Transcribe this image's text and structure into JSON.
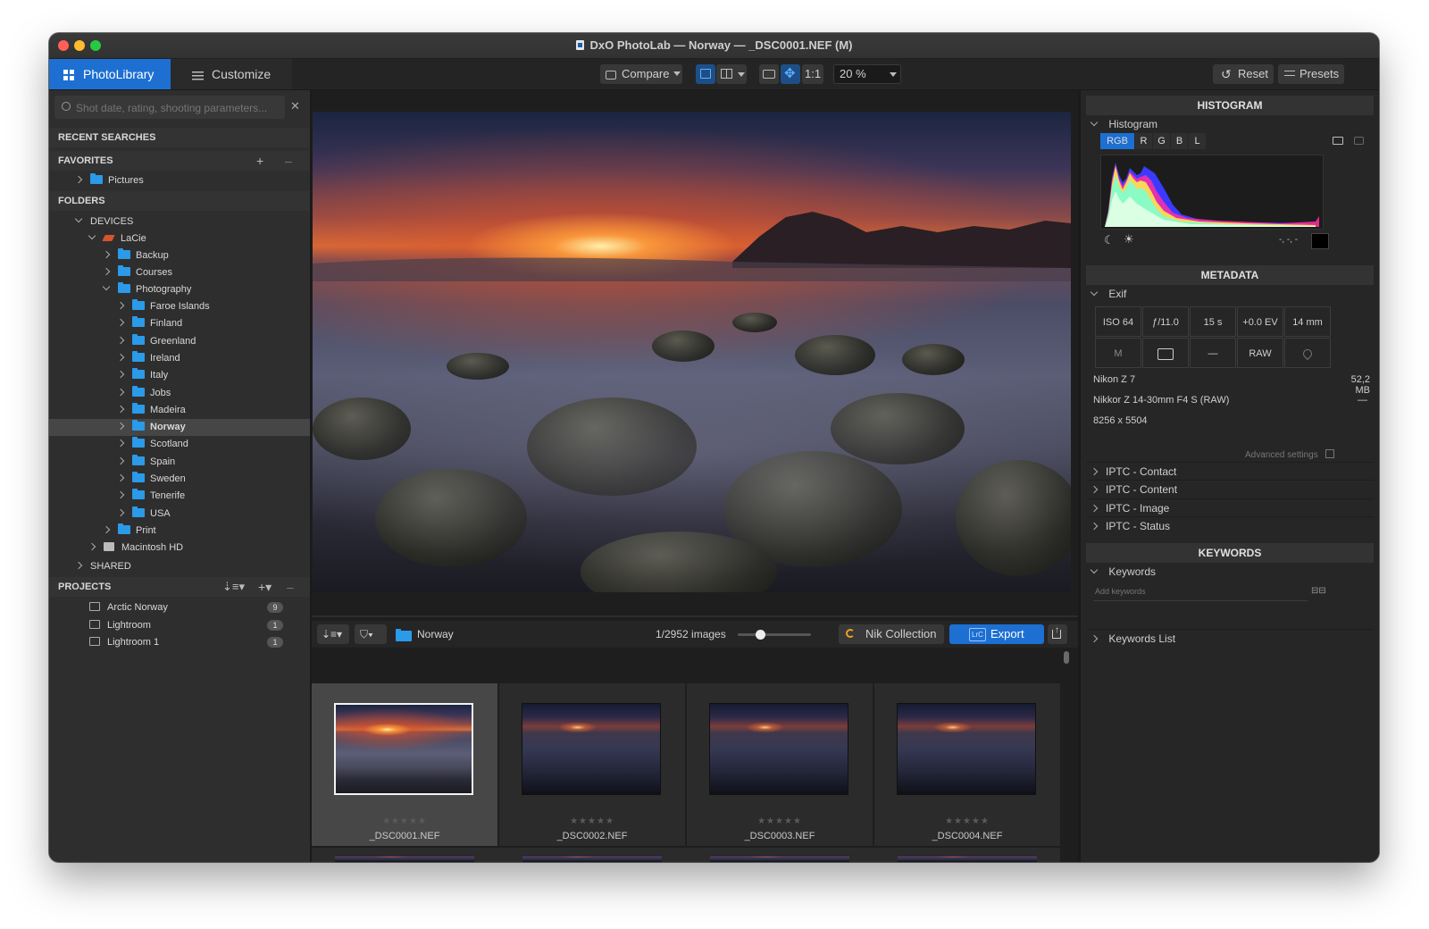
{
  "window": {
    "title": "DxO PhotoLab — Norway — _DSC0001.NEF (M)"
  },
  "toolbar": {
    "tab_library": "PhotoLibrary",
    "tab_customize": "Customize",
    "compare_label": "Compare",
    "one_to_one": "1:1",
    "zoom": "20 %",
    "reset_label": "Reset",
    "presets_label": "Presets"
  },
  "sidebar": {
    "search_placeholder": "Shot date, rating, shooting parameters...",
    "recent_searches": "RECENT SEARCHES",
    "favorites": "FAVORITES",
    "fav_items": [
      "Pictures"
    ],
    "folders": "FOLDERS",
    "devices": "DEVICES",
    "drive": "LaCie",
    "drive_children": [
      "Backup",
      "Courses",
      "Photography"
    ],
    "photography_children": [
      "Faroe Islands",
      "Finland",
      "Greenland",
      "Ireland",
      "Italy",
      "Jobs",
      "Madeira",
      "Norway",
      "Scotland",
      "Spain",
      "Sweden",
      "Tenerife",
      "USA"
    ],
    "print_folder": "Print",
    "macintosh": "Macintosh HD",
    "shared": "SHARED",
    "projects": "PROJECTS",
    "project_items": [
      {
        "name": "Arctic Norway",
        "count": "9"
      },
      {
        "name": "Lightroom",
        "count": "1"
      },
      {
        "name": "Lightroom 1",
        "count": "1"
      }
    ],
    "selected_folder": "Norway"
  },
  "filmstrip": {
    "folder": "Norway",
    "count": "1/2952 images",
    "slider_value": 0.3,
    "nik_label": "Nik Collection",
    "export_label": "Export",
    "lrc_badge": "LrC",
    "thumbs": [
      {
        "name": "_DSC0001.NEF",
        "stars": "★★★★★"
      },
      {
        "name": "_DSC0002.NEF",
        "stars": "★★★★★"
      },
      {
        "name": "_DSC0003.NEF",
        "stars": "★★★★★"
      },
      {
        "name": "_DSC0004.NEF",
        "stars": "★★★★★"
      }
    ]
  },
  "histogram": {
    "header": "HISTOGRAM",
    "label": "Histogram",
    "channels": [
      "RGB",
      "R",
      "G",
      "B",
      "L"
    ],
    "readout": "-, -, -"
  },
  "metadata": {
    "header": "METADATA",
    "exif_label": "Exif",
    "row1": [
      "ISO 64",
      "ƒ/11.0",
      "15 s",
      "+0.0 EV",
      "14 mm"
    ],
    "row2": [
      "M",
      "",
      "—",
      "RAW",
      ""
    ],
    "camera": "Nikon Z 7",
    "size": "52,2 MB",
    "lens": "Nikkor Z 14-30mm F4 S (RAW)",
    "lens_dash": "—",
    "dimensions": "8256 x 5504",
    "advanced": "Advanced settings",
    "iptc": [
      "IPTC - Contact",
      "IPTC - Content",
      "IPTC - Image",
      "IPTC - Status"
    ]
  },
  "keywords": {
    "header": "KEYWORDS",
    "label": "Keywords",
    "placeholder": "Add keywords",
    "list_label": "Keywords List"
  },
  "colors": {
    "accent": "#1d6fd2",
    "selected_row": "#464646",
    "folder": "#2b9ae8"
  }
}
